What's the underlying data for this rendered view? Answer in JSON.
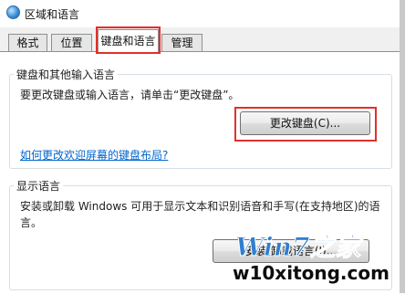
{
  "window": {
    "title": "区域和语言"
  },
  "tabs": [
    {
      "label": "格式"
    },
    {
      "label": "位置"
    },
    {
      "label": "键盘和语言"
    },
    {
      "label": "管理"
    }
  ],
  "keyboard_group": {
    "title": "键盘和其他输入语言",
    "description": "要更改键盘或输入语言，请单击“更改键盘”。",
    "button_label": "更改键盘(C)...",
    "link_text": "如何更改欢迎屏幕的键盘布局?"
  },
  "display_group": {
    "title": "显示语言",
    "description_line1": "安装或卸载 Windows 可用于显示文本和识别语音和手写(在支持地区)的语",
    "description_line2": "言。",
    "button_label": "安装/卸载语言(I)..."
  },
  "watermark": {
    "logo_text": "Win7之家",
    "domain": "w10xitong.com"
  },
  "colors": {
    "highlight": "#e0312b",
    "link": "#0066cc"
  }
}
